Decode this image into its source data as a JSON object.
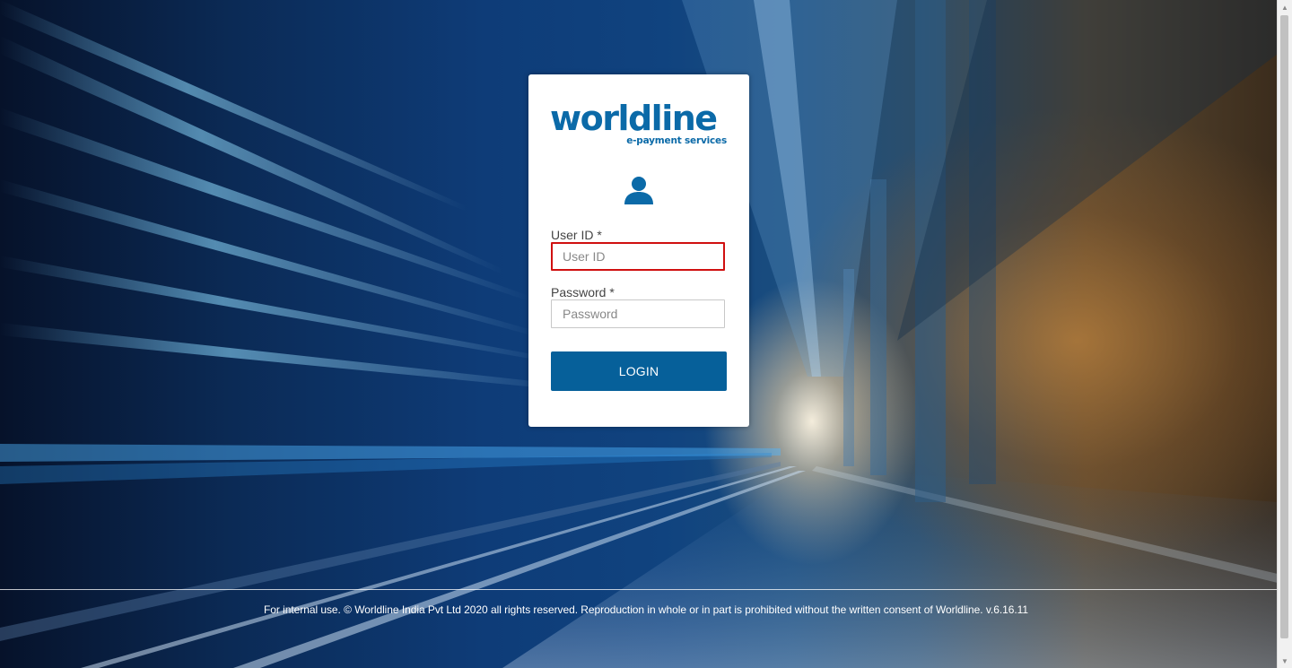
{
  "brand": {
    "name": "worldline",
    "tagline": "e-payment services",
    "color": "#0b6aa8"
  },
  "login": {
    "user_icon": "user-icon",
    "user_id": {
      "label": "User ID *",
      "placeholder": "User ID",
      "value": "",
      "border_color": "#d01010"
    },
    "password": {
      "label": "Password *",
      "placeholder": "Password",
      "value": ""
    },
    "submit_label": "LOGIN",
    "button_color": "#06609a"
  },
  "footer": {
    "text": "For internal use. © Worldline India Pvt Ltd 2020 all rights reserved. Reproduction in whole or in part is prohibited without the written consent of Worldline. v.6.16.11"
  }
}
